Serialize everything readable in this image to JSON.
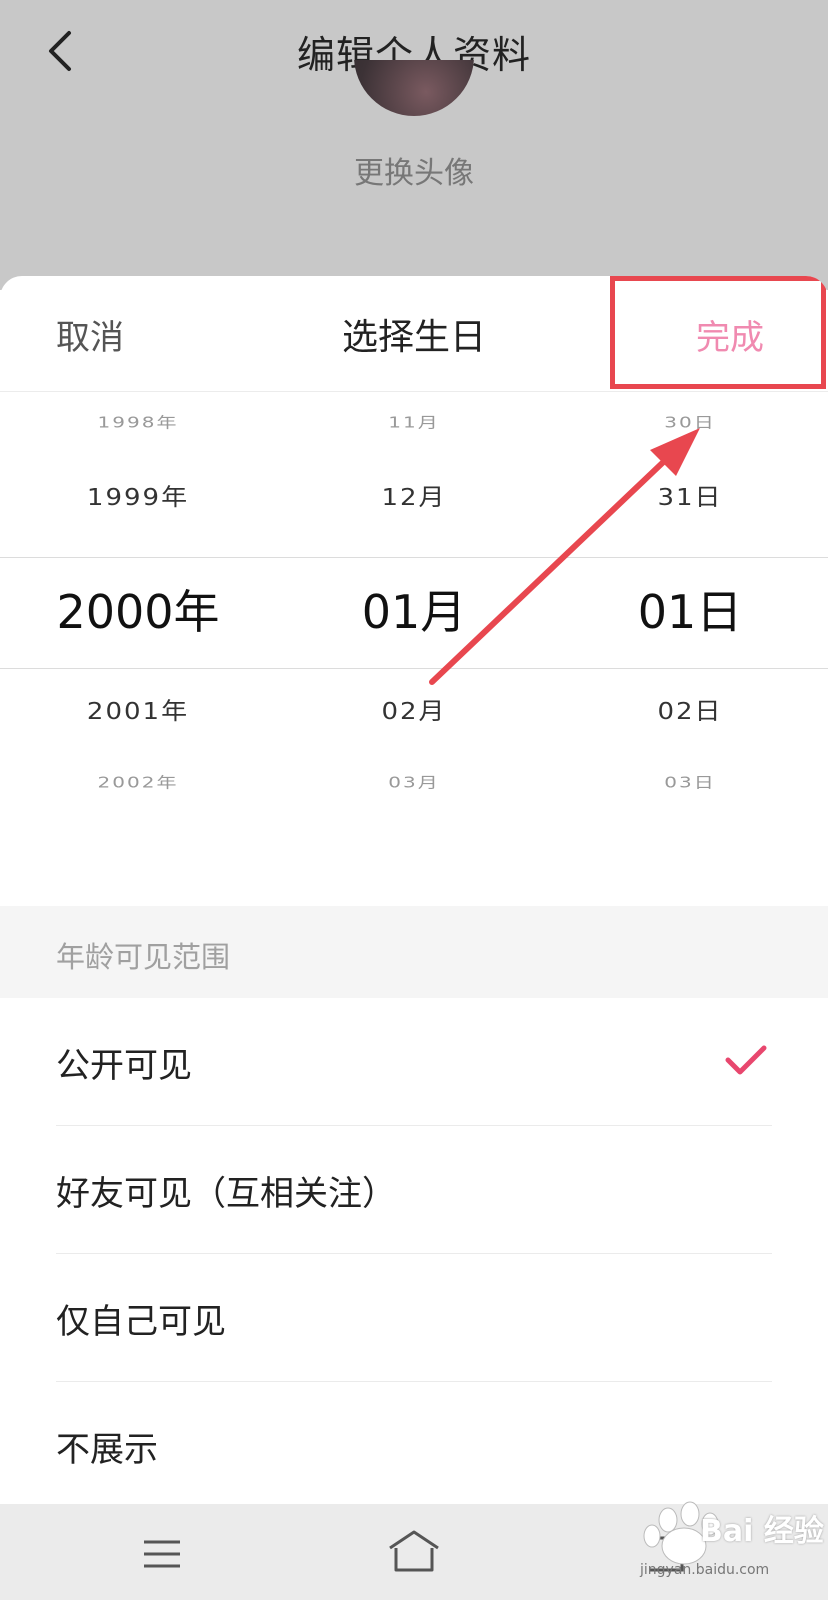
{
  "page": {
    "title": "编辑个人资料",
    "change_avatar": "更换头像"
  },
  "sheet": {
    "cancel": "取消",
    "title": "选择生日",
    "done": "完成"
  },
  "picker": {
    "rows": [
      {
        "year": "1998年",
        "month": "11月",
        "day": "30日"
      },
      {
        "year": "1999年",
        "month": "12月",
        "day": "31日"
      },
      {
        "year": "2000年",
        "month": "01月",
        "day": "01日"
      },
      {
        "year": "2001年",
        "month": "02月",
        "day": "02日"
      },
      {
        "year": "2002年",
        "month": "03月",
        "day": "03日"
      }
    ]
  },
  "visibility": {
    "section_label": "年龄可见范围",
    "options": [
      "公开可见",
      "好友可见（互相关注）",
      "仅自己可见",
      "不展示"
    ],
    "selected": "公开可见"
  },
  "watermark": {
    "text": "Bai 经验",
    "sub": "jingyan.baidu.com"
  },
  "colors": {
    "accent": "#f08ab0",
    "check": "#e8476e",
    "annotation": "#e8474f"
  },
  "icons": {
    "back": "chevron-left-icon",
    "check": "checkmark-icon",
    "nav_menu": "menu-icon",
    "nav_home": "home-icon",
    "nav_back": "back-nav-icon"
  }
}
